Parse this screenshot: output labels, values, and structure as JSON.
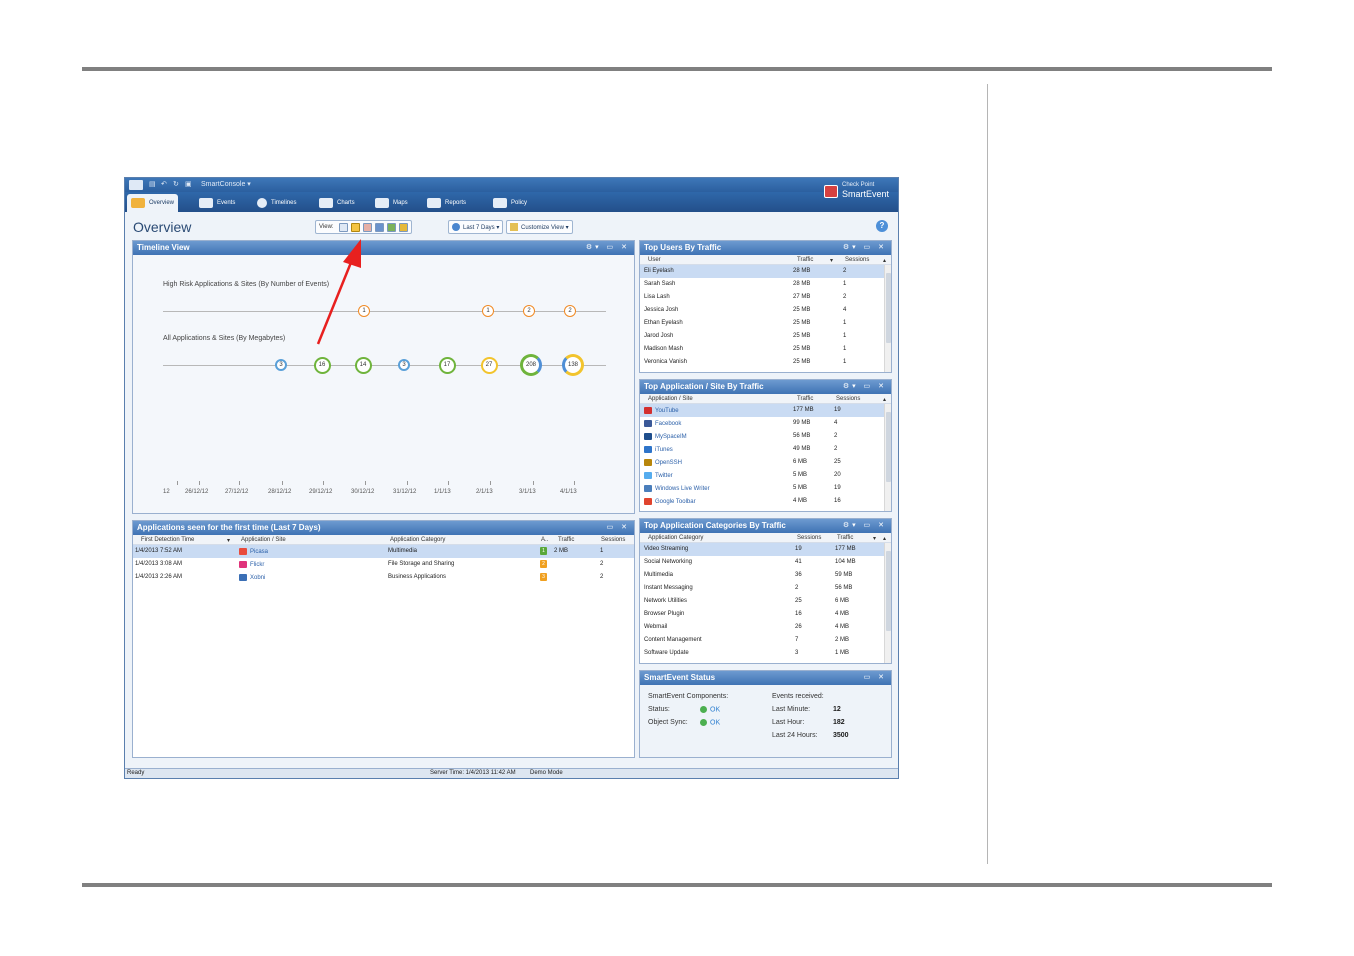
{
  "app": {
    "quick_access_label": "SmartConsole ▾",
    "brand_line1": "Check Point",
    "brand_line2": "SmartEvent",
    "accent": "#2b5f9f"
  },
  "tabs": [
    {
      "label": "Overview",
      "icon": "gauge-icon"
    },
    {
      "label": "Events",
      "icon": "grid-icon"
    },
    {
      "label": "Timelines",
      "icon": "timeline-icon"
    },
    {
      "label": "Charts",
      "icon": "bar-chart-icon"
    },
    {
      "label": "Maps",
      "icon": "map-icon"
    },
    {
      "label": "Reports",
      "icon": "report-icon"
    },
    {
      "label": "Policy",
      "icon": "policy-icon"
    }
  ],
  "toolbar": {
    "page_title": "Overview",
    "view_label": "View:",
    "range_label": "Last 7 Days ▾",
    "customize_label": "Customize View ▾",
    "help": "?"
  },
  "timeline": {
    "title": "Timeline View",
    "controls": "⚙▾ ▭ ✕",
    "high_risk_label": "High Risk Applications & Sites (By Number of Events)",
    "all_apps_label": "All Applications & Sites (By Megabytes)",
    "high_risk_values": [
      "1",
      "1",
      "2",
      "2"
    ],
    "all_values": [
      "3",
      "16",
      "14",
      "3",
      "17",
      "27",
      "208",
      "138"
    ],
    "dates": [
      "12",
      "26/12/12",
      "27/12/12",
      "28/12/12",
      "29/12/12",
      "30/12/12",
      "31/12/12",
      "1/1/13",
      "2/1/13",
      "3/1/13",
      "4/1/13"
    ]
  },
  "first_seen": {
    "title": "Applications seen for the first time (Last 7 Days)",
    "controls": "▭ ✕",
    "columns": [
      "First Detection Time",
      "▾",
      "Application / Site",
      "Application Category",
      "A..",
      "Traffic",
      "Sessions"
    ],
    "rows": [
      {
        "time": "1/4/2013 7:52 AM",
        "app": "Picasa",
        "category": "Multimedia",
        "risk": "1",
        "traffic": "2 MB",
        "sessions": "1",
        "icon": "picasa-icon"
      },
      {
        "time": "1/4/2013 3:08 AM",
        "app": "Flickr",
        "category": "File Storage and Sharing",
        "risk": "2",
        "traffic": "",
        "sessions": "2",
        "icon": "flickr-icon"
      },
      {
        "time": "1/4/2013 2:26 AM",
        "app": "Xobni",
        "category": "Business Applications",
        "risk": "3",
        "traffic": "",
        "sessions": "2",
        "icon": "xobni-icon"
      }
    ]
  },
  "top_users": {
    "title": "Top Users By Traffic",
    "controls": "⚙▾ ▭ ✕",
    "columns": [
      "User",
      "Traffic",
      "▾",
      "Sessions",
      "▴"
    ],
    "rows": [
      {
        "user": "Eli Eyelash",
        "traffic": "28 MB",
        "sessions": "2"
      },
      {
        "user": "Sarah Sash",
        "traffic": "28 MB",
        "sessions": "1"
      },
      {
        "user": "Lisa Lash",
        "traffic": "27 MB",
        "sessions": "2"
      },
      {
        "user": "Jessica Josh",
        "traffic": "25 MB",
        "sessions": "4"
      },
      {
        "user": "Ethan Eyelash",
        "traffic": "25 MB",
        "sessions": "1"
      },
      {
        "user": "Jarod Josh",
        "traffic": "25 MB",
        "sessions": "1"
      },
      {
        "user": "Madison Mash",
        "traffic": "25 MB",
        "sessions": "1"
      },
      {
        "user": "Veronica Vanish",
        "traffic": "25 MB",
        "sessions": "1"
      }
    ]
  },
  "top_apps": {
    "title": "Top Application / Site By Traffic",
    "controls": "⚙▾ ▭ ✕",
    "columns": [
      "Application / Site",
      "Traffic",
      "Sessions",
      "▴"
    ],
    "rows": [
      {
        "app": "YouTube",
        "traffic": "177 MB",
        "sessions": "19",
        "icon": "youtube-icon",
        "color": "#d32f2f"
      },
      {
        "app": "Facebook",
        "traffic": "99 MB",
        "sessions": "4",
        "icon": "facebook-icon",
        "color": "#3b5998"
      },
      {
        "app": "MySpaceIM",
        "traffic": "56 MB",
        "sessions": "2",
        "icon": "myspace-icon",
        "color": "#1f4e8c"
      },
      {
        "app": "iTunes",
        "traffic": "49 MB",
        "sessions": "2",
        "icon": "itunes-icon",
        "color": "#2e74c9"
      },
      {
        "app": "OpenSSH",
        "traffic": "6 MB",
        "sessions": "25",
        "icon": "openssh-icon",
        "color": "#b8860b"
      },
      {
        "app": "Twitter",
        "traffic": "5 MB",
        "sessions": "20",
        "icon": "twitter-icon",
        "color": "#55acee"
      },
      {
        "app": "Windows Live Writer",
        "traffic": "5 MB",
        "sessions": "19",
        "icon": "windows-live-writer-icon",
        "color": "#4a7ebb"
      },
      {
        "app": "Google Toolbar",
        "traffic": "4 MB",
        "sessions": "16",
        "icon": "google-toolbar-icon",
        "color": "#e0442e"
      }
    ]
  },
  "top_categories": {
    "title": "Top Application Categories By Traffic",
    "controls": "⚙▾ ▭ ✕",
    "columns": [
      "Application Category",
      "Sessions",
      "Traffic",
      "▾",
      "▴"
    ],
    "rows": [
      {
        "category": "Video Streaming",
        "sessions": "19",
        "traffic": "177 MB"
      },
      {
        "category": "Social Networking",
        "sessions": "41",
        "traffic": "104 MB"
      },
      {
        "category": "Multimedia",
        "sessions": "36",
        "traffic": "59 MB"
      },
      {
        "category": "Instant Messaging",
        "sessions": "2",
        "traffic": "56 MB"
      },
      {
        "category": "Network Utilities",
        "sessions": "25",
        "traffic": "6 MB"
      },
      {
        "category": "Browser Plugin",
        "sessions": "16",
        "traffic": "4 MB"
      },
      {
        "category": "Webmail",
        "sessions": "26",
        "traffic": "4 MB"
      },
      {
        "category": "Content Management",
        "sessions": "7",
        "traffic": "2 MB"
      },
      {
        "category": "Software Update",
        "sessions": "3",
        "traffic": "1 MB"
      }
    ]
  },
  "smartevent_status": {
    "title": "SmartEvent Status",
    "controls": "▭ ✕",
    "components_label": "SmartEvent Components:",
    "status_label": "Status:",
    "status_value": "OK",
    "sync_label": "Object Sync:",
    "sync_value": "OK",
    "events_label": "Events received:",
    "last_minute_label": "Last Minute:",
    "last_minute_value": "12",
    "last_hour_label": "Last Hour:",
    "last_hour_value": "182",
    "last_24_label": "Last 24 Hours:",
    "last_24_value": "3500"
  },
  "statusbar": {
    "ready": "Ready",
    "server_time": "Server Time: 1/4/2013 11:42 AM",
    "mode": "Demo Mode"
  }
}
